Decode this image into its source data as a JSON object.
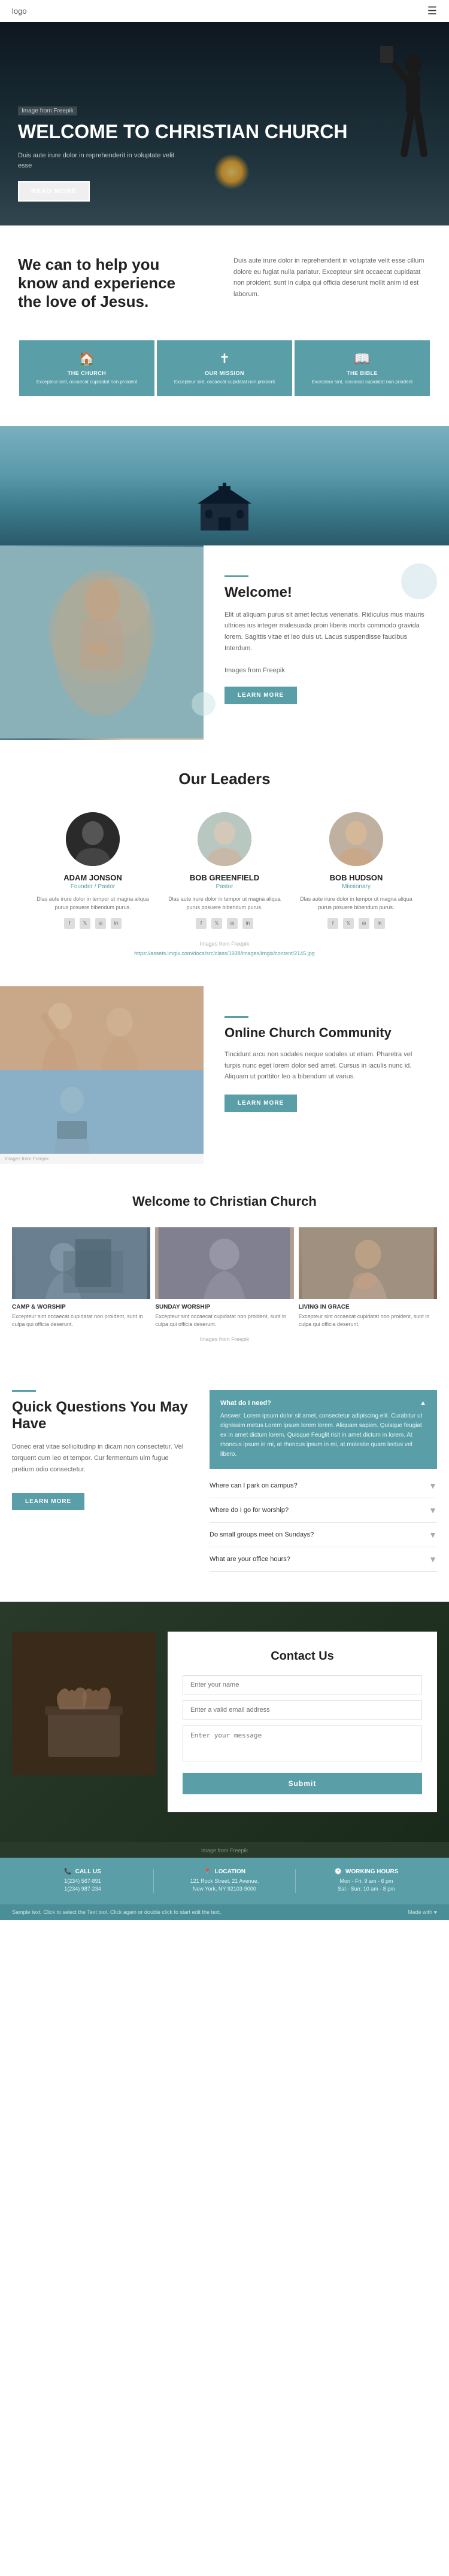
{
  "nav": {
    "logo": "logo",
    "hamburger_icon": "☰"
  },
  "hero": {
    "tag": "Image from Freepik",
    "title": "WELCOME TO\nCHRISTIAN CHURCH",
    "desc": "Duis aute irure dolor in reprehenderit in voluptate velit esse",
    "btn_label": "READ MORE"
  },
  "intro": {
    "heading": "We can to help you know and experience the love of Jesus.",
    "para": "Duis aute irure dolor in reprehenderit in voluptate velit esse cillum dolore eu fugiat nulla pariatur. Excepteur sint occaecat cupidatat non proident, sunt in culpa qui officia deserunt mollit anim id est laborum.",
    "cards": [
      {
        "icon": "🏠",
        "title": "THE CHURCH",
        "desc": "Excepteur sint, occaecat cupidatat non proident"
      },
      {
        "icon": "✝",
        "title": "OUR MISSION",
        "desc": "Excepteur sint, occaecat cupidatat non proident"
      },
      {
        "icon": "📖",
        "title": "THE BIBLE",
        "desc": "Excepteur sint, occaecat cupidatat non proident"
      }
    ]
  },
  "welcome": {
    "tag": "Images from Freepik",
    "heading": "Welcome!",
    "para1": "Elit ut aliquam purus sit amet lectus venenatis. Ridiculus mus mauris ultrices ius integer malesuada proin liberis morbi commodo gravida lorem. Sagittis vitae et leo duis ut. Lacus suspendisse faucibus Interdum.",
    "para2": "Images from Freepik",
    "btn_label": "LEARN MORE"
  },
  "leaders": {
    "heading": "Our Leaders",
    "source": "Images from Freepik",
    "url": "https://assets.imgix.com/docs/src/class/1938/images/imgix/content/2145.jpg",
    "people": [
      {
        "name": "ADAM JONSON",
        "role": "Founder / Pastor",
        "desc": "Dlas aute irure dolor in tempor ut magna aliqua purus posuere bibendum purus."
      },
      {
        "name": "BOB GREENFIELD",
        "role": "Pastor",
        "desc": "Dlas aute irure dolor in tempor ut magna aliqua purus posuere bibendum purus."
      },
      {
        "name": "BOB HUDSON",
        "role": "Missionary",
        "desc": "Dlas aute irure dolor in tempor ut magna aliqua purus posuere bibendum purus."
      }
    ],
    "social_icons": [
      "f",
      "y",
      "◎",
      "in"
    ]
  },
  "community": {
    "source": "Images from Freepik",
    "heading": "Online Church Community",
    "para": "Tincidunt arcu non sodales neque sodales ut etiam. Pharetra vel turpis nunc eget lorem dolor sed amet. Cursus in iaculis nunc id. Aliquam ut porttitor leo a bibendum ut varius.",
    "btn_label": "LEARN MORE"
  },
  "church_section": {
    "heading": "Welcome to Christian Church",
    "source": "Images from Freepik",
    "cards": [
      {
        "label": "Camp & Worship",
        "desc": "Excepteur sint occaecat cupidatat non proident, sunt in culpa qui officia deserunt."
      },
      {
        "label": "Sunday Worship",
        "desc": "Excepteur sint occaecat cupidatat non proident, sunt in culpa qui officia deserunt."
      },
      {
        "label": "Living in Grace",
        "desc": "Excepteur sint occaecat cupidatat non proident, sunt in culpa qui officia deserunt."
      }
    ]
  },
  "faq": {
    "heading": "Quick Questions You May Have",
    "para": "Donec erat vitae sollicitudinp in dicam non consectetur. Vel torquent cum leo et tempor. Cur fermentum ulm fugue pretium odio consectetur.",
    "btn_label": "LEARN MORE",
    "featured": {
      "question": "What do I need?",
      "answer": "Answer: Lorem ipsum dolor sit amet, consectetur adipiscing elit. Curabitur ut dignissim metus Lorem ipsum lorem lorem. Aliquam sapien. Quisque feugiat ex in amet dictum lorem. Quisque Feuglit risit in amet dictum in lorem. At rhoncus ipsum in mi, at rhoncus ipsum in mi, at molestie quam lectus vel libero."
    },
    "items": [
      {
        "question": "Where can I park on campus?"
      },
      {
        "question": "Where do I go for worship?"
      },
      {
        "question": "Do small groups meet on Sundays?"
      },
      {
        "question": "What are your office hours?"
      }
    ]
  },
  "contact": {
    "heading": "Contact Us",
    "source": "Image from Freepik",
    "fields": {
      "name_placeholder": "Enter your name",
      "email_placeholder": "Enter a valid email address",
      "message_placeholder": "Enter your message",
      "submit_label": "Submit"
    }
  },
  "footer": {
    "cols": [
      {
        "icon": "📞",
        "title": "CALL US",
        "lines": [
          "1(234) 567-891",
          "1(234) 987-234"
        ]
      },
      {
        "icon": "📍",
        "title": "LOCATION",
        "lines": [
          "121 Rock Street, 21 Avenue,",
          "New York, NY 92103-9000"
        ]
      },
      {
        "icon": "🕐",
        "title": "WORKING HOURS",
        "lines": [
          "Mon - Fri: 9 am - 6 pm",
          "Sat - Sun: 10 am - 8 pm"
        ]
      }
    ],
    "bottom_text": "Sample text. Click to select the Text tool. Click again or double click to start edit the text.",
    "bottom_right": "Made with ♥"
  }
}
